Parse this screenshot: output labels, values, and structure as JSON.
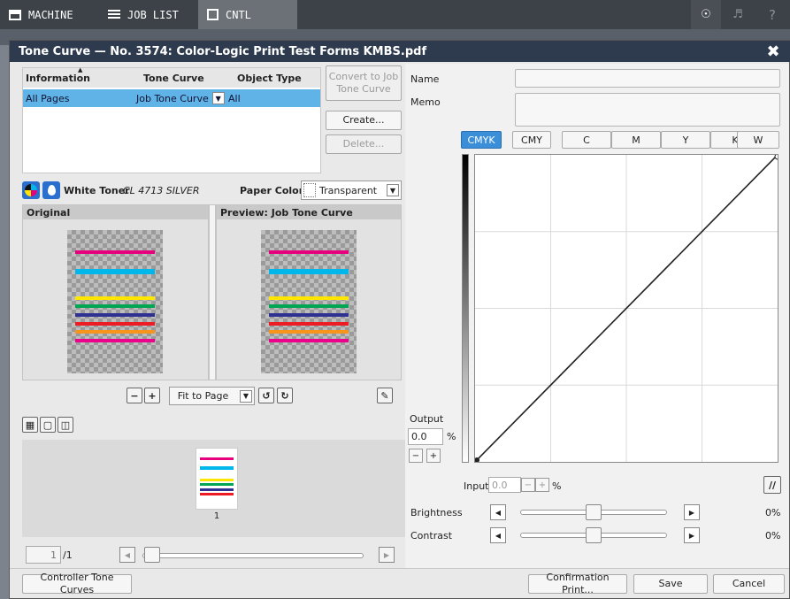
{
  "topbar": {
    "items": [
      {
        "label": "MACHINE",
        "icon": "printer-icon"
      },
      {
        "label": "JOB LIST",
        "icon": "list-icon"
      },
      {
        "label": "CNTL",
        "icon": "control-icon"
      }
    ],
    "globe_icon": "globe-icon",
    "volume_icon": "volume-icon",
    "help_label": "?"
  },
  "dialog": {
    "title": "Tone Curve — No. 3574: Color-Logic Print Test Forms KMBS.pdf",
    "close_label": "✖"
  },
  "info_table": {
    "headers": [
      "Information",
      "Tone Curve",
      "Object Type"
    ],
    "rows": [
      {
        "information": "All Pages",
        "tone_curve": "Job Tone Curve",
        "object_type": "All"
      }
    ]
  },
  "buttons": {
    "convert": "Convert to Job Tone Curve",
    "create": "Create...",
    "delete": "Delete..."
  },
  "toner": {
    "label": "White Toner",
    "value": "CL 4713 SILVER",
    "paper_color_label": "Paper Color",
    "paper_color_value": "Transparent"
  },
  "panes": {
    "original_label": "Original",
    "preview_label": "Preview: Job Tone Curve"
  },
  "zoom": {
    "fit_label": "Fit to Page"
  },
  "filmstrip": {
    "page_number": "1"
  },
  "paging": {
    "current": "1",
    "total": "/1"
  },
  "right": {
    "name_label": "Name",
    "memo_label": "Memo",
    "name_value": "",
    "memo_value": "",
    "channels": [
      "CMYK",
      "CMY",
      "C",
      "M",
      "Y",
      "K",
      "W"
    ],
    "selected_channel": "CMYK",
    "output_label": "Output",
    "output_value": "0.0",
    "percent": "%",
    "input_label": "Input",
    "input_value": "0.0",
    "minus": "−",
    "plus": "+",
    "brightness_label": "Brightness",
    "brightness_value": "0%",
    "brightness_level": 0,
    "contrast_label": "Contrast",
    "contrast_value": "0%",
    "contrast_level": 0
  },
  "footer": {
    "controller_tone_curves": "Controller Tone Curves",
    "confirmation_print": "Confirmation Print...",
    "save": "Save",
    "cancel": "Cancel"
  },
  "colors": {
    "title_bar": "#2e3b4e",
    "selection": "#5fb3e6",
    "accent": "#3b8fd9"
  }
}
